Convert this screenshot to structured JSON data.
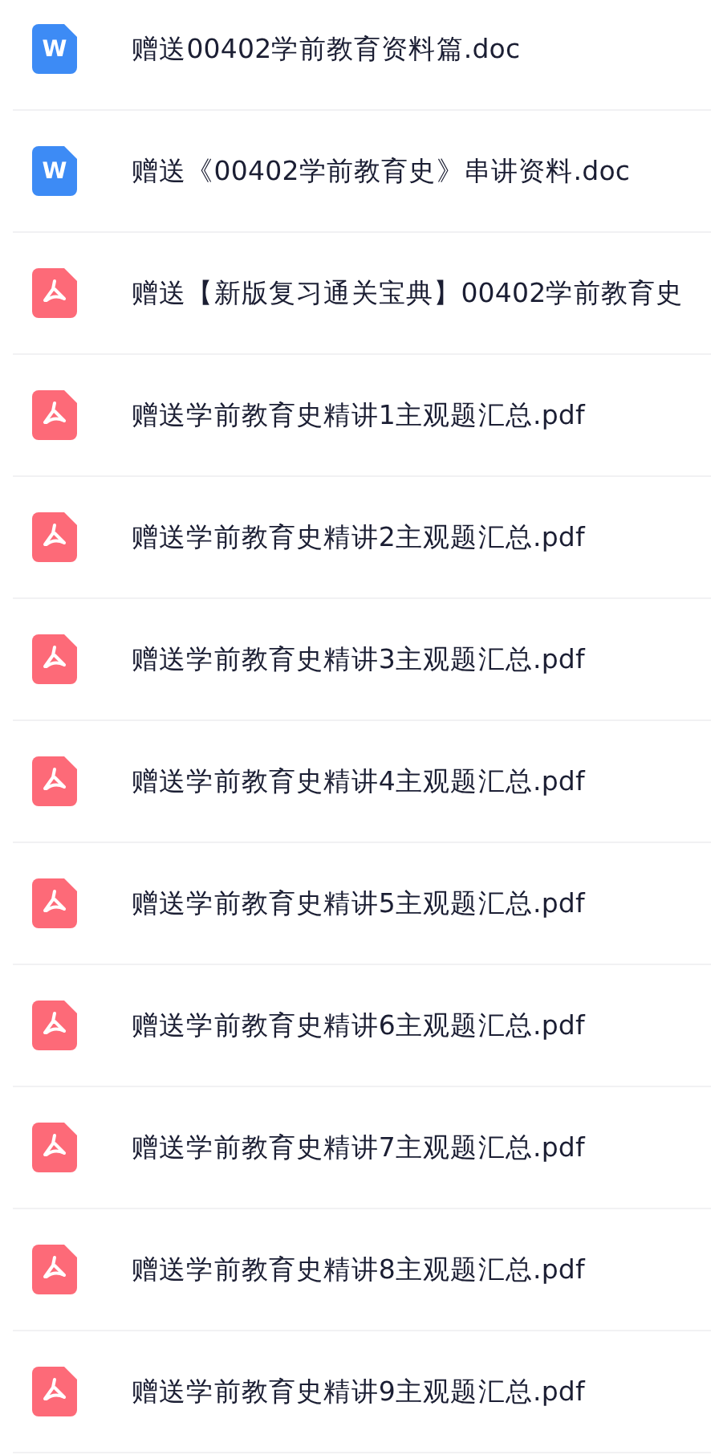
{
  "files": [
    {
      "kind": "doc",
      "icon_letter": "W",
      "name": "赠送00402学前教育资料篇.doc"
    },
    {
      "kind": "doc",
      "icon_letter": "W",
      "name": "赠送《00402学前教育史》串讲资料.doc"
    },
    {
      "kind": "pdf",
      "name": "赠送【新版复习通关宝典】00402学前教育史"
    },
    {
      "kind": "pdf",
      "name": "赠送学前教育史精讲1主观题汇总.pdf"
    },
    {
      "kind": "pdf",
      "name": "赠送学前教育史精讲2主观题汇总.pdf"
    },
    {
      "kind": "pdf",
      "name": "赠送学前教育史精讲3主观题汇总.pdf"
    },
    {
      "kind": "pdf",
      "name": "赠送学前教育史精讲4主观题汇总.pdf"
    },
    {
      "kind": "pdf",
      "name": "赠送学前教育史精讲5主观题汇总.pdf"
    },
    {
      "kind": "pdf",
      "name": "赠送学前教育史精讲6主观题汇总.pdf"
    },
    {
      "kind": "pdf",
      "name": "赠送学前教育史精讲7主观题汇总.pdf"
    },
    {
      "kind": "pdf",
      "name": "赠送学前教育史精讲8主观题汇总.pdf"
    },
    {
      "kind": "pdf",
      "name": "赠送学前教育史精讲9主观题汇总.pdf"
    }
  ]
}
